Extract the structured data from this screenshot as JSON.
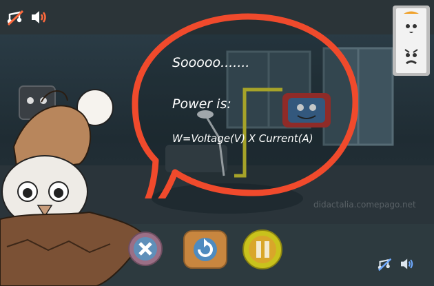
{
  "speech": {
    "line1": "Sooooo.......",
    "line2": "Power is:",
    "line3": "W=Voltage(V) X Current(A)"
  },
  "watermark": "didactalia.comepago.net",
  "colors": {
    "speech_border": "#f04a2c",
    "close_button": "#9b6f86",
    "replay_button": "#c8863f",
    "pause_button": "#c9c21c",
    "top_bar": "#2b3438",
    "bottom_bar": "#2d3a3f"
  },
  "icons": {
    "music_mute": "music-muted-icon",
    "sound": "speaker-icon",
    "character_card": "emotion-card-icon",
    "close": "close-icon",
    "replay": "replay-icon",
    "pause": "pause-icon"
  }
}
